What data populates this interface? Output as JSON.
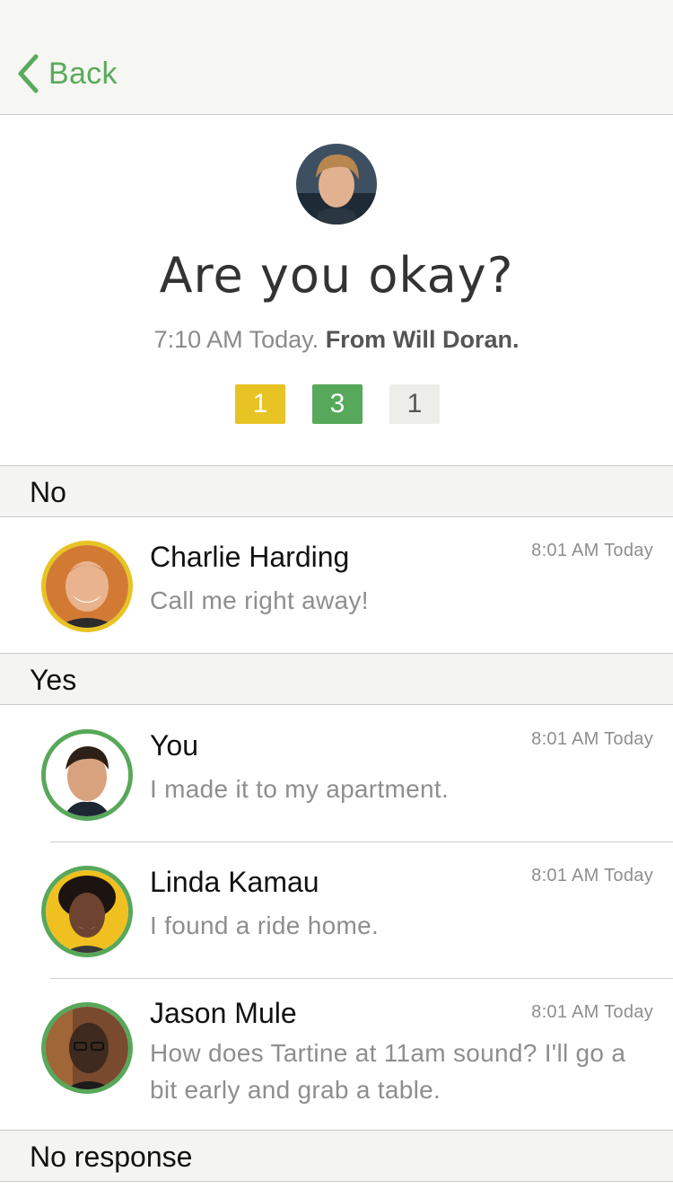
{
  "nav": {
    "back_label": "Back"
  },
  "alert": {
    "title": "Are you okay?",
    "time": "7:10 AM Today.",
    "from": "From Will Doran.",
    "counts": {
      "no": "1",
      "yes": "3",
      "none": "1"
    }
  },
  "sections": {
    "no": {
      "label": "No",
      "items": [
        {
          "name": "Charlie Harding",
          "message": "Call me right away!",
          "time": "8:01 AM Today"
        }
      ]
    },
    "yes": {
      "label": "Yes",
      "items": [
        {
          "name": "You",
          "message": "I made it to my apartment.",
          "time": "8:01 AM Today"
        },
        {
          "name": "Linda Kamau",
          "message": "I found a ride home.",
          "time": "8:01 AM Today"
        },
        {
          "name": "Jason Mule",
          "message": "How does Tartine at 11am sound? I'll go a bit early and grab a table.",
          "time": "8:01 AM Today"
        }
      ]
    },
    "none": {
      "label": "No response"
    }
  },
  "colors": {
    "accent": "#5aaa5c",
    "yellow": "#e7c323",
    "green": "#57a85a"
  }
}
